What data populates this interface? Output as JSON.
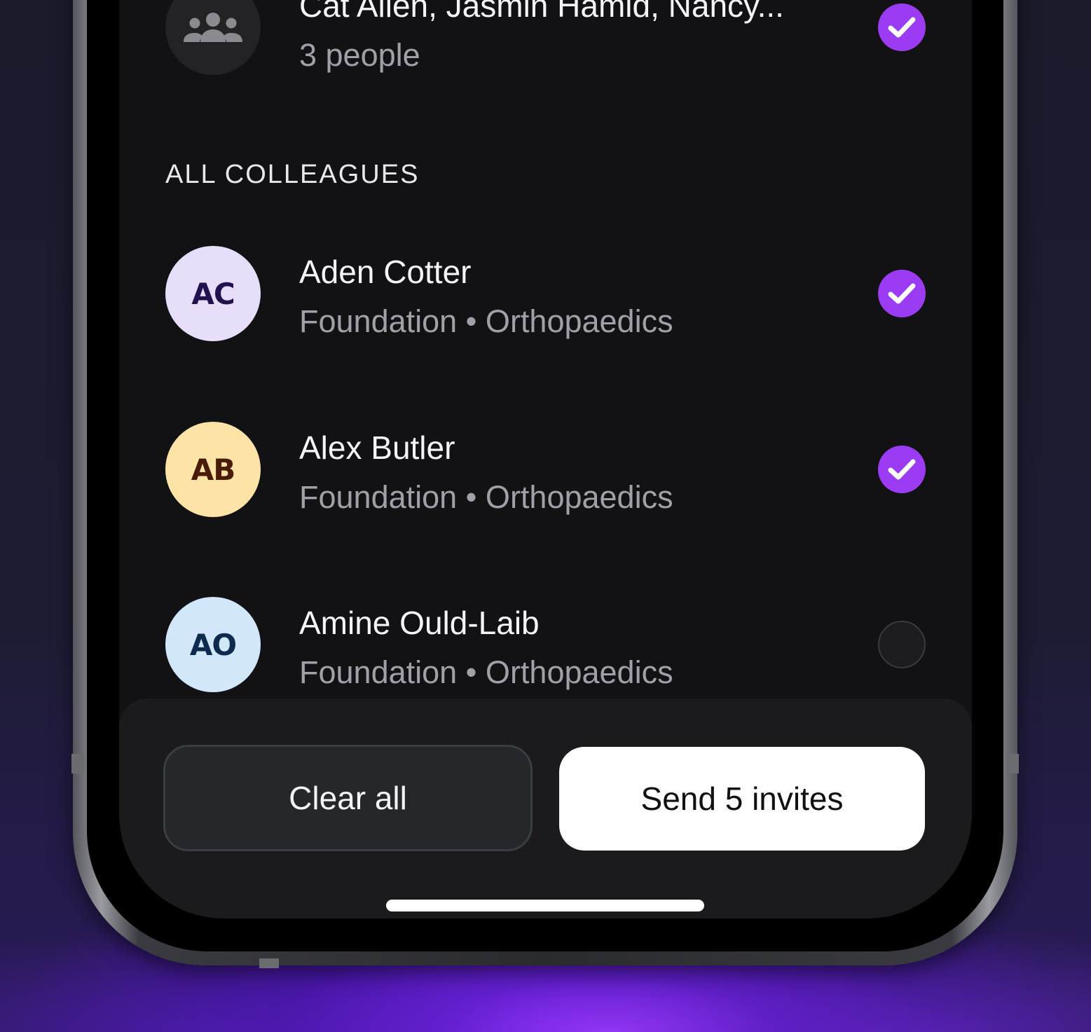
{
  "group": {
    "title": "Cat Allen, Jasmin Hamid, Nancy...",
    "subtitle": "3 people",
    "selected": true,
    "icon": "group-people-icon"
  },
  "section": {
    "label": "ALL COLLEAGUES"
  },
  "colleagues": [
    {
      "initials": "AC",
      "name": "Aden Cotter",
      "detail": "Foundation • Orthopaedics",
      "selected": true,
      "avatar_color": "#e6defa"
    },
    {
      "initials": "AB",
      "name": "Alex Butler",
      "detail": "Foundation • Orthopaedics",
      "selected": true,
      "avatar_color": "#fde4a6"
    },
    {
      "initials": "AO",
      "name": "Amine Ould-Laib",
      "detail": "Foundation • Orthopaedics",
      "selected": false,
      "avatar_color": "#d3e7fb"
    }
  ],
  "actions": {
    "clear_label": "Clear all",
    "send_label": "Send 5 invites"
  },
  "colors": {
    "accent": "#9b3cf4",
    "screen_bg": "#121215",
    "bar_bg": "#1b1b1e"
  }
}
